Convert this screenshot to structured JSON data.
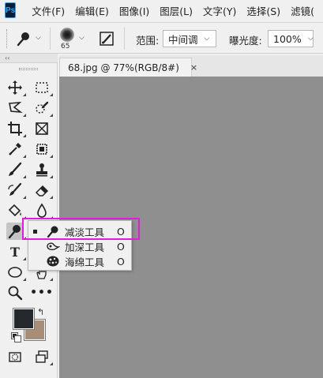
{
  "menubar": {
    "logo": "Ps",
    "items": [
      "文件(F)",
      "编辑(E)",
      "图像(I)",
      "图层(L)",
      "文字(Y)",
      "选择(S)",
      "滤镜("
    ]
  },
  "options": {
    "brush_size": "65",
    "range_label": "范围:",
    "range_value": "中间调",
    "exposure_label": "曝光度:",
    "exposure_value": "100%"
  },
  "toolbar": {
    "collapse": "‹‹",
    "type_tool": "T",
    "more": "•••",
    "foreground_color": "#25282c",
    "background_color": "#a88e78"
  },
  "document": {
    "tab_title": "68.jpg @ 77%(RGB/8#)",
    "close": "×",
    "canvas_color": "#8f8f8f"
  },
  "flyout": {
    "items": [
      {
        "name": "减淡工具",
        "key": "O",
        "icon": "dodge-icon",
        "selected": true
      },
      {
        "name": "加深工具",
        "key": "O",
        "icon": "burn-icon",
        "selected": false
      },
      {
        "name": "海绵工具",
        "key": "O",
        "icon": "sponge-icon",
        "selected": false
      }
    ],
    "highlight_color": "#e21bdd"
  }
}
